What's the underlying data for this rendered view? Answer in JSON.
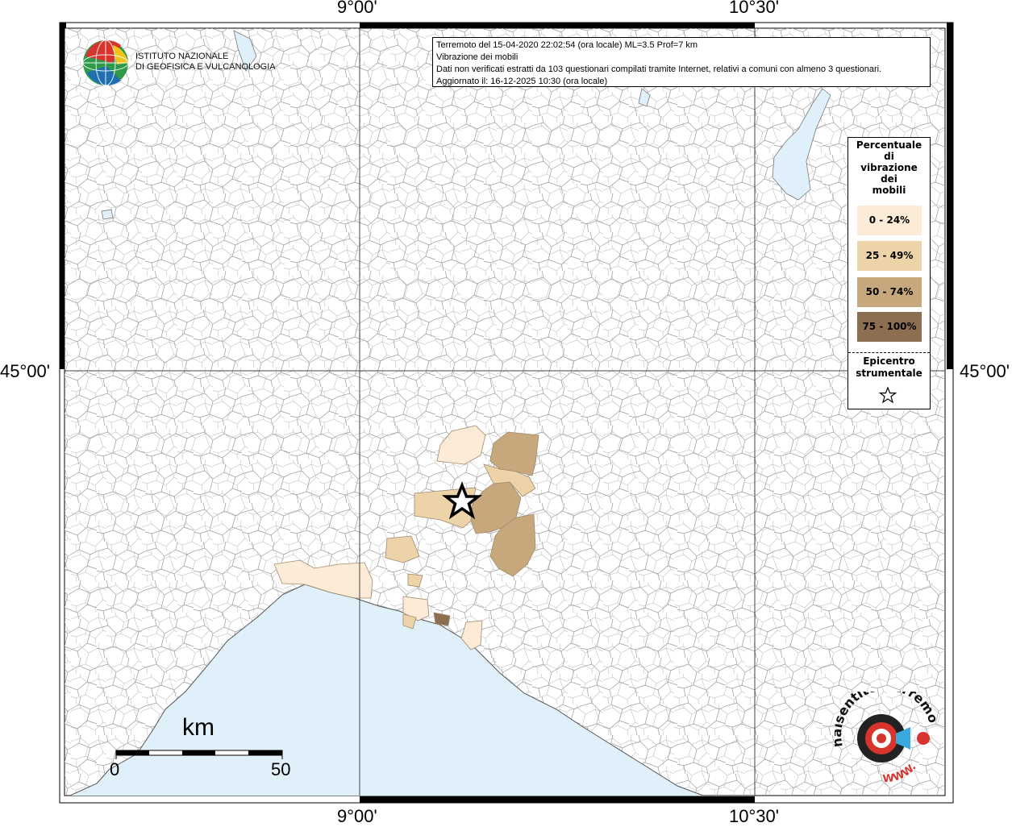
{
  "info": {
    "line1": "Terremoto del 15-04-2020 22:02:54 (ora locale) ML=3.5 Prof=7 km",
    "line2": "Vibrazione dei mobili",
    "line3": "Dati non verificati estratti da 103 questionari compilati tramite Internet, relativi a comuni con almeno 3 questionari.",
    "line4": "Aggiornato il: 16-12-2025 10:30 (ora locale)"
  },
  "logo": {
    "line1": "ISTITUTO NAZIONALE",
    "line2": "DI GEOFISICA E VULCANOLOGIA"
  },
  "coords": {
    "top_left": "9°00'",
    "top_right": "10°30'",
    "bottom_left": "9°00'",
    "bottom_right": "10°30'",
    "left_lat": "45°00'",
    "right_lat": "45°00'"
  },
  "legend": {
    "title": [
      "Percentuale",
      "di",
      "vibrazione",
      "dei",
      "mobili"
    ],
    "classes": [
      {
        "label": "0 - 24%",
        "color": "#fcebd6"
      },
      {
        "label": "25 - 49%",
        "color": "#ecd3a8"
      },
      {
        "label": "50 - 74%",
        "color": "#c7a77c"
      },
      {
        "label": "75 - 100%",
        "color": "#8c6e50"
      }
    ],
    "epicenter": [
      "Epicentro",
      "strumentale"
    ]
  },
  "scale": {
    "unit": "km",
    "start": "0",
    "end": "50"
  },
  "watermark": {
    "text": "haisentitoilterremoto.it",
    "url": "WWW."
  },
  "colors": {
    "sea": "#dff0fb",
    "border": "#8a8a8a",
    "grid": "#444444"
  }
}
